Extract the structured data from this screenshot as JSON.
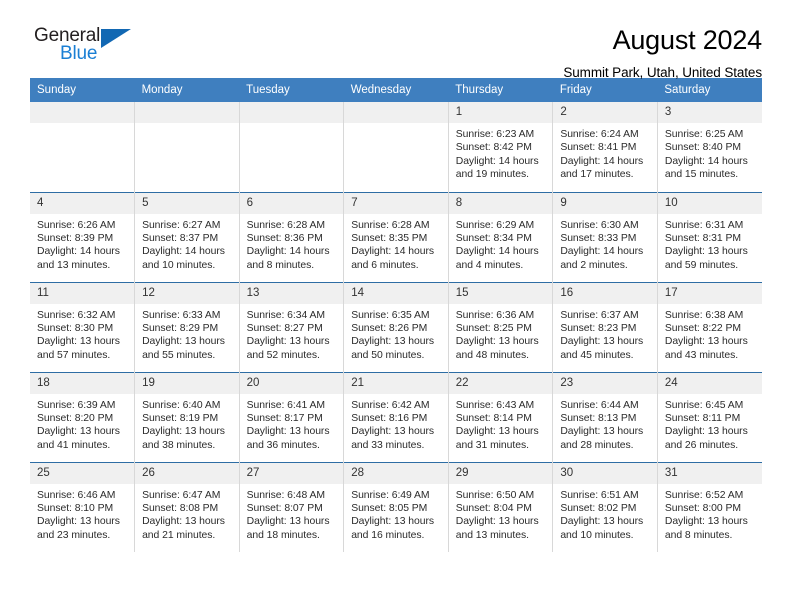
{
  "brand": {
    "name_part1": "General",
    "name_part2": "Blue",
    "triangle_color": "#1268b3",
    "blue_color": "#1a7fd4"
  },
  "header": {
    "title": "August 2024",
    "subtitle": "Summit Park, Utah, United States"
  },
  "theme": {
    "header_row_bg": "#3f7fbf",
    "header_row_text": "#ffffff",
    "daynum_bg": "#f0f0f0",
    "row_divider": "#2e6da4",
    "cell_divider": "#d8d8d8"
  },
  "weekdays": [
    "Sunday",
    "Monday",
    "Tuesday",
    "Wednesday",
    "Thursday",
    "Friday",
    "Saturday"
  ],
  "labels": {
    "sunrise": "Sunrise:",
    "sunset": "Sunset:",
    "daylight": "Daylight:"
  },
  "weeks": [
    [
      {
        "day": "",
        "empty": true,
        "sunrise": "",
        "sunset": "",
        "daylight": ""
      },
      {
        "day": "",
        "empty": true,
        "sunrise": "",
        "sunset": "",
        "daylight": ""
      },
      {
        "day": "",
        "empty": true,
        "sunrise": "",
        "sunset": "",
        "daylight": ""
      },
      {
        "day": "",
        "empty": true,
        "sunrise": "",
        "sunset": "",
        "daylight": ""
      },
      {
        "day": "1",
        "empty": false,
        "sunrise": "Sunrise: 6:23 AM",
        "sunset": "Sunset: 8:42 PM",
        "daylight": "Daylight: 14 hours and 19 minutes."
      },
      {
        "day": "2",
        "empty": false,
        "sunrise": "Sunrise: 6:24 AM",
        "sunset": "Sunset: 8:41 PM",
        "daylight": "Daylight: 14 hours and 17 minutes."
      },
      {
        "day": "3",
        "empty": false,
        "sunrise": "Sunrise: 6:25 AM",
        "sunset": "Sunset: 8:40 PM",
        "daylight": "Daylight: 14 hours and 15 minutes."
      }
    ],
    [
      {
        "day": "4",
        "empty": false,
        "sunrise": "Sunrise: 6:26 AM",
        "sunset": "Sunset: 8:39 PM",
        "daylight": "Daylight: 14 hours and 13 minutes."
      },
      {
        "day": "5",
        "empty": false,
        "sunrise": "Sunrise: 6:27 AM",
        "sunset": "Sunset: 8:37 PM",
        "daylight": "Daylight: 14 hours and 10 minutes."
      },
      {
        "day": "6",
        "empty": false,
        "sunrise": "Sunrise: 6:28 AM",
        "sunset": "Sunset: 8:36 PM",
        "daylight": "Daylight: 14 hours and 8 minutes."
      },
      {
        "day": "7",
        "empty": false,
        "sunrise": "Sunrise: 6:28 AM",
        "sunset": "Sunset: 8:35 PM",
        "daylight": "Daylight: 14 hours and 6 minutes."
      },
      {
        "day": "8",
        "empty": false,
        "sunrise": "Sunrise: 6:29 AM",
        "sunset": "Sunset: 8:34 PM",
        "daylight": "Daylight: 14 hours and 4 minutes."
      },
      {
        "day": "9",
        "empty": false,
        "sunrise": "Sunrise: 6:30 AM",
        "sunset": "Sunset: 8:33 PM",
        "daylight": "Daylight: 14 hours and 2 minutes."
      },
      {
        "day": "10",
        "empty": false,
        "sunrise": "Sunrise: 6:31 AM",
        "sunset": "Sunset: 8:31 PM",
        "daylight": "Daylight: 13 hours and 59 minutes."
      }
    ],
    [
      {
        "day": "11",
        "empty": false,
        "sunrise": "Sunrise: 6:32 AM",
        "sunset": "Sunset: 8:30 PM",
        "daylight": "Daylight: 13 hours and 57 minutes."
      },
      {
        "day": "12",
        "empty": false,
        "sunrise": "Sunrise: 6:33 AM",
        "sunset": "Sunset: 8:29 PM",
        "daylight": "Daylight: 13 hours and 55 minutes."
      },
      {
        "day": "13",
        "empty": false,
        "sunrise": "Sunrise: 6:34 AM",
        "sunset": "Sunset: 8:27 PM",
        "daylight": "Daylight: 13 hours and 52 minutes."
      },
      {
        "day": "14",
        "empty": false,
        "sunrise": "Sunrise: 6:35 AM",
        "sunset": "Sunset: 8:26 PM",
        "daylight": "Daylight: 13 hours and 50 minutes."
      },
      {
        "day": "15",
        "empty": false,
        "sunrise": "Sunrise: 6:36 AM",
        "sunset": "Sunset: 8:25 PM",
        "daylight": "Daylight: 13 hours and 48 minutes."
      },
      {
        "day": "16",
        "empty": false,
        "sunrise": "Sunrise: 6:37 AM",
        "sunset": "Sunset: 8:23 PM",
        "daylight": "Daylight: 13 hours and 45 minutes."
      },
      {
        "day": "17",
        "empty": false,
        "sunrise": "Sunrise: 6:38 AM",
        "sunset": "Sunset: 8:22 PM",
        "daylight": "Daylight: 13 hours and 43 minutes."
      }
    ],
    [
      {
        "day": "18",
        "empty": false,
        "sunrise": "Sunrise: 6:39 AM",
        "sunset": "Sunset: 8:20 PM",
        "daylight": "Daylight: 13 hours and 41 minutes."
      },
      {
        "day": "19",
        "empty": false,
        "sunrise": "Sunrise: 6:40 AM",
        "sunset": "Sunset: 8:19 PM",
        "daylight": "Daylight: 13 hours and 38 minutes."
      },
      {
        "day": "20",
        "empty": false,
        "sunrise": "Sunrise: 6:41 AM",
        "sunset": "Sunset: 8:17 PM",
        "daylight": "Daylight: 13 hours and 36 minutes."
      },
      {
        "day": "21",
        "empty": false,
        "sunrise": "Sunrise: 6:42 AM",
        "sunset": "Sunset: 8:16 PM",
        "daylight": "Daylight: 13 hours and 33 minutes."
      },
      {
        "day": "22",
        "empty": false,
        "sunrise": "Sunrise: 6:43 AM",
        "sunset": "Sunset: 8:14 PM",
        "daylight": "Daylight: 13 hours and 31 minutes."
      },
      {
        "day": "23",
        "empty": false,
        "sunrise": "Sunrise: 6:44 AM",
        "sunset": "Sunset: 8:13 PM",
        "daylight": "Daylight: 13 hours and 28 minutes."
      },
      {
        "day": "24",
        "empty": false,
        "sunrise": "Sunrise: 6:45 AM",
        "sunset": "Sunset: 8:11 PM",
        "daylight": "Daylight: 13 hours and 26 minutes."
      }
    ],
    [
      {
        "day": "25",
        "empty": false,
        "sunrise": "Sunrise: 6:46 AM",
        "sunset": "Sunset: 8:10 PM",
        "daylight": "Daylight: 13 hours and 23 minutes."
      },
      {
        "day": "26",
        "empty": false,
        "sunrise": "Sunrise: 6:47 AM",
        "sunset": "Sunset: 8:08 PM",
        "daylight": "Daylight: 13 hours and 21 minutes."
      },
      {
        "day": "27",
        "empty": false,
        "sunrise": "Sunrise: 6:48 AM",
        "sunset": "Sunset: 8:07 PM",
        "daylight": "Daylight: 13 hours and 18 minutes."
      },
      {
        "day": "28",
        "empty": false,
        "sunrise": "Sunrise: 6:49 AM",
        "sunset": "Sunset: 8:05 PM",
        "daylight": "Daylight: 13 hours and 16 minutes."
      },
      {
        "day": "29",
        "empty": false,
        "sunrise": "Sunrise: 6:50 AM",
        "sunset": "Sunset: 8:04 PM",
        "daylight": "Daylight: 13 hours and 13 minutes."
      },
      {
        "day": "30",
        "empty": false,
        "sunrise": "Sunrise: 6:51 AM",
        "sunset": "Sunset: 8:02 PM",
        "daylight": "Daylight: 13 hours and 10 minutes."
      },
      {
        "day": "31",
        "empty": false,
        "sunrise": "Sunrise: 6:52 AM",
        "sunset": "Sunset: 8:00 PM",
        "daylight": "Daylight: 13 hours and 8 minutes."
      }
    ]
  ]
}
